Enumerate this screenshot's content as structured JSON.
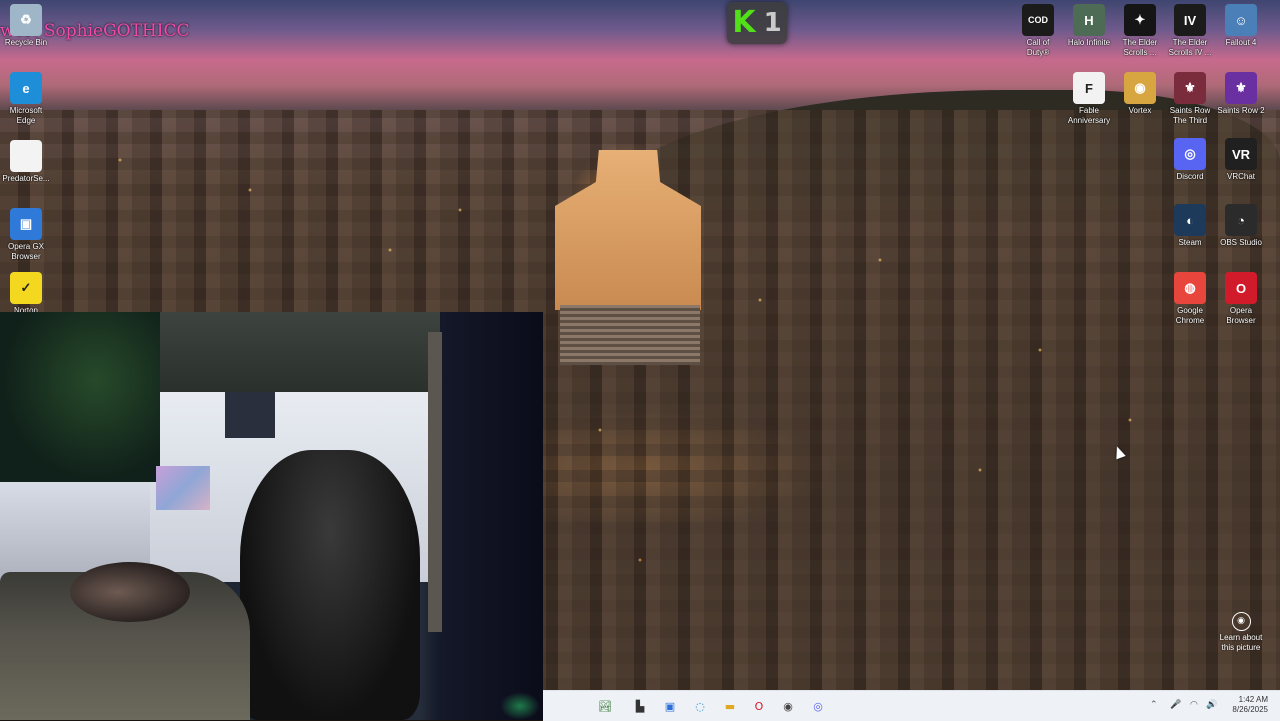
{
  "overlay": {
    "viewer_label": "wer: SophieGOTHICC",
    "kick_letter": "K",
    "kick_count": "1",
    "kick_color": "#52e019"
  },
  "desktop_left": [
    {
      "label": "Recycle Bin",
      "icon": "recycle-bin-icon",
      "color": "#9fb5c8",
      "glyph": "♻"
    },
    {
      "label": "Microsoft\nEdge",
      "icon": "edge-icon",
      "color": "#1f8ed8",
      "glyph": "e"
    },
    {
      "label": "PredatorSe...",
      "icon": "file-icon",
      "color": "#f3f3f3",
      "glyph": ""
    },
    {
      "label": "Opera GX\nBrowser",
      "icon": "opera-gx-icon",
      "color": "#2f7ad8",
      "glyph": "▣"
    },
    {
      "label": "Norton",
      "icon": "norton-icon",
      "color": "#f4d820",
      "glyph": "✓"
    }
  ],
  "desktop_right": [
    {
      "label": "Call of\nDuty®",
      "icon": "call-of-duty-icon",
      "color": "#1b1b1b",
      "glyph": "COD"
    },
    {
      "label": "Halo Infinite",
      "icon": "halo-infinite-icon",
      "color": "#4d6b55",
      "glyph": "H"
    },
    {
      "label": "The Elder\nScrolls ...",
      "icon": "elder-scrolls-icon",
      "color": "#151515",
      "glyph": "✦"
    },
    {
      "label": "The Elder\nScrolls IV ...",
      "icon": "elder-scrolls-iv-icon",
      "color": "#1b1b1b",
      "glyph": "IV"
    },
    {
      "label": "Fallout 4",
      "icon": "fallout-4-icon",
      "color": "#4b7fb8",
      "glyph": "☺"
    },
    {
      "label": "Fable\nAnniversary",
      "icon": "fable-icon",
      "color": "#f2f2f2",
      "glyph": "F"
    },
    {
      "label": "Vortex",
      "icon": "vortex-icon",
      "color": "#d8a640",
      "glyph": "◉"
    },
    {
      "label": "Saints Row\nThe Third",
      "icon": "saints-row-the-third-icon",
      "color": "#7a2c3c",
      "glyph": "⚜"
    },
    {
      "label": "Saints Row 2",
      "icon": "saints-row-2-icon",
      "color": "#6a2fa0",
      "glyph": "⚜"
    },
    {
      "label": "Discord",
      "icon": "discord-icon",
      "color": "#5865f2",
      "glyph": "◎"
    },
    {
      "label": "VRChat",
      "icon": "vrchat-icon",
      "color": "#202020",
      "glyph": "VR"
    },
    {
      "label": "Steam",
      "icon": "steam-icon",
      "color": "#1d3a5a",
      "glyph": "◐"
    },
    {
      "label": "OBS Studio",
      "icon": "obs-studio-icon",
      "color": "#2b2b2b",
      "glyph": "◔"
    },
    {
      "label": "Google\nChrome",
      "icon": "chrome-icon",
      "color": "#e8453c",
      "glyph": "◍"
    },
    {
      "label": "Opera\nBrowser",
      "icon": "opera-icon",
      "color": "#d21b2a",
      "glyph": "O"
    }
  ],
  "learn": {
    "label": "Learn about\nthis picture",
    "icon": "camera-icon"
  },
  "taskbar": {
    "apps": [
      {
        "name": "taskbar-widgets-icon",
        "glyph": "🏞"
      },
      {
        "name": "taskbar-taskview-icon",
        "glyph": "▙"
      },
      {
        "name": "taskbar-store-icon",
        "glyph": "▣"
      },
      {
        "name": "taskbar-edge-icon",
        "glyph": "◌"
      },
      {
        "name": "taskbar-explorer-icon",
        "glyph": "▬"
      },
      {
        "name": "taskbar-opera-icon",
        "glyph": "O"
      },
      {
        "name": "taskbar-app-icon",
        "glyph": "◉"
      },
      {
        "name": "taskbar-discord-icon",
        "glyph": "◎"
      }
    ],
    "time": "1:42 AM",
    "date": "8/26/2025"
  }
}
